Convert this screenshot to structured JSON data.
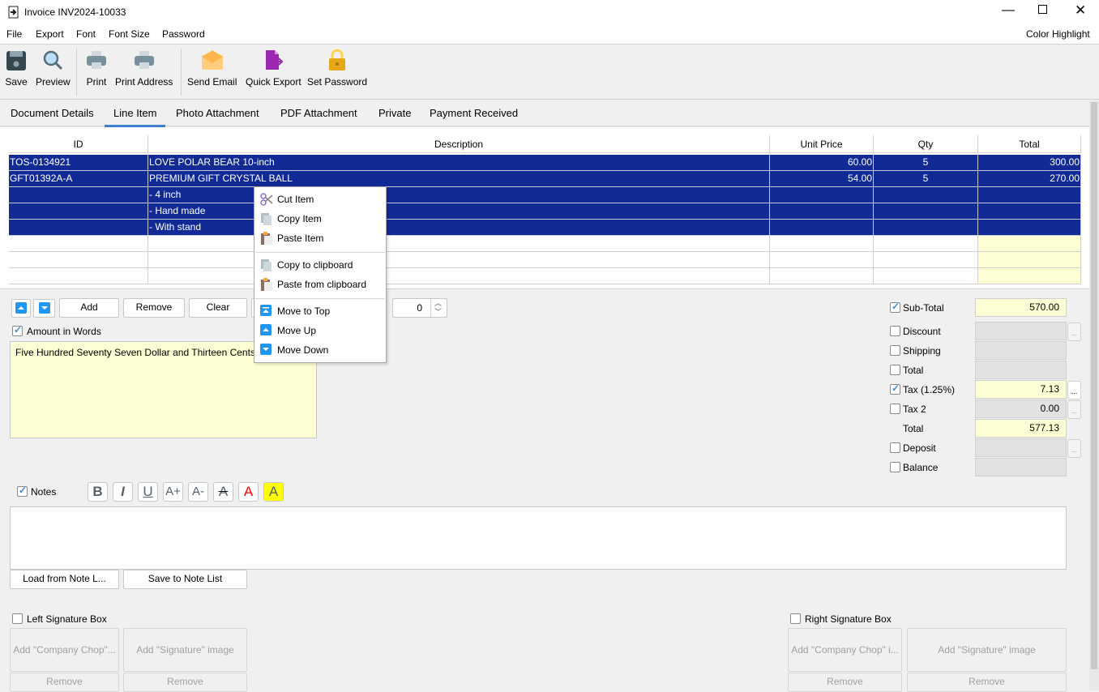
{
  "window": {
    "title": "Invoice INV2024-10033",
    "controls": [
      "minimize",
      "maximize",
      "close"
    ]
  },
  "menu": {
    "items": [
      "File",
      "Export",
      "Font",
      "Font Size",
      "Password"
    ],
    "right": "Color Highlight"
  },
  "toolbar": {
    "save": "Save",
    "preview": "Preview",
    "print": "Print",
    "print_address": "Print Address",
    "send_email": "Send Email",
    "quick_export": "Quick Export",
    "set_password": "Set Password"
  },
  "tabs": [
    "Document Details",
    "Line Item",
    "Photo Attachment",
    "PDF Attachment",
    "Private",
    "Payment Received"
  ],
  "active_tab": "Line Item",
  "grid": {
    "columns": [
      "ID",
      "Description",
      "Unit Price",
      "Qty",
      "Total"
    ],
    "rows": [
      [
        "TOS-0134921",
        "LOVE POLAR BEAR 10-inch",
        "60.00",
        "5",
        "300.00"
      ],
      [
        "GFT01392A-A",
        "PREMIUM GIFT CRYSTAL BALL",
        "54.00",
        "5",
        "270.00"
      ],
      [
        "",
        "- 4 inch",
        "",
        "",
        ""
      ],
      [
        "",
        "- Hand made",
        "",
        "",
        ""
      ],
      [
        "",
        "- With stand",
        "",
        "",
        ""
      ]
    ],
    "selection_color": "#112a96"
  },
  "context_menu": {
    "items": [
      "Cut Item",
      "Copy Item",
      "Paste Item",
      "Copy to clipboard",
      "Paste from clipboard",
      "Move to Top",
      "Move Up",
      "Move Down"
    ]
  },
  "actions": {
    "add": "Add",
    "remove": "Remove",
    "clear": "Clear",
    "spinner_value": "0"
  },
  "amount_words": {
    "label": "Amount in Words",
    "checked": true,
    "text": "Five Hundred Seventy Seven Dollar and Thirteen Cents"
  },
  "totals": [
    {
      "label": "Sub-Total",
      "checked": true,
      "value": "570.00"
    },
    {
      "label": "Discount",
      "checked": false,
      "value": ""
    },
    {
      "label": "Shipping",
      "checked": false,
      "value": ""
    },
    {
      "label": "Total",
      "checked": false,
      "value": ""
    },
    {
      "label": "Tax (1.25%)",
      "checked": true,
      "value": "7.13"
    },
    {
      "label": "Tax 2",
      "checked": false,
      "value": "0.00"
    },
    {
      "label": "Total",
      "value": "577.13"
    },
    {
      "label": "Deposit",
      "checked": false,
      "value": ""
    },
    {
      "label": "Balance",
      "checked": false,
      "value": ""
    }
  ],
  "notes": {
    "label": "Notes",
    "checked": true,
    "text": "",
    "load": "Load from Note L...",
    "save": "Save to Note List",
    "format": [
      "B",
      "I",
      "U",
      "A+",
      "A-",
      "A",
      "A",
      "A"
    ]
  },
  "signature": {
    "left": {
      "label": "Left Signature Box",
      "chop": "Add \"Company Chop\"...",
      "sig": "Add \"Signature\" image",
      "remove": "Remove"
    },
    "right": {
      "label": "Right Signature Box",
      "chop": "Add \"Company Chop\" i...",
      "sig": "Add \"Signature\" image",
      "remove": "Remove"
    }
  }
}
